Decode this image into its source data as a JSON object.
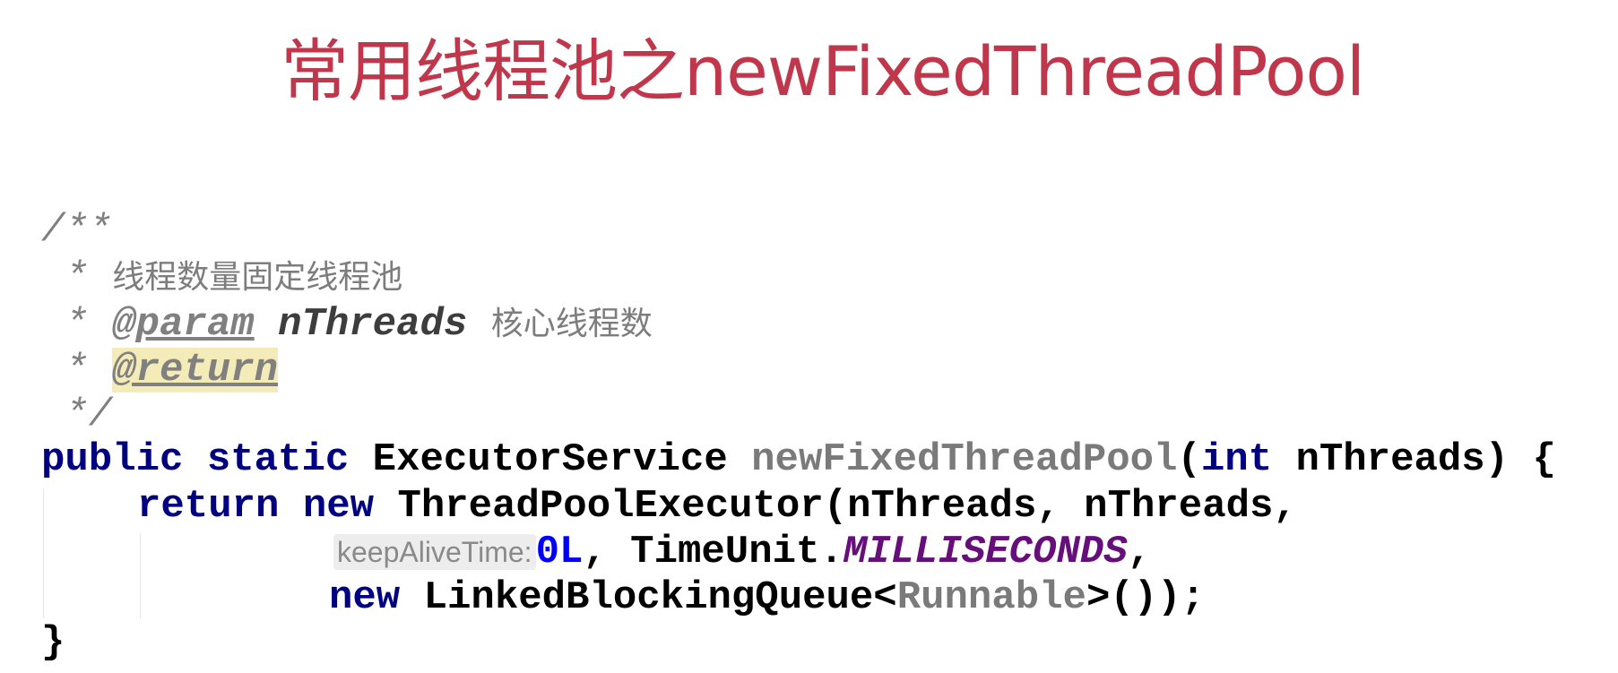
{
  "slide": {
    "title": "常用线程池之newFixedThreadPool",
    "colors": {
      "title": "#c0364a",
      "keyword": "#000080",
      "constant": "#660e7a",
      "number": "#0000ff",
      "comment": "#808080"
    }
  },
  "code": {
    "comment_open": "/**",
    "comment_star": " * ",
    "comment_desc": "线程数量固定线程池",
    "param_tag": "@param",
    "param_name": "nThreads",
    "param_desc": "核心线程数",
    "return_tag": "@return",
    "comment_close": " */",
    "l1_kw": "public static ",
    "l1_type": "ExecutorService ",
    "l1_method": "newFixedThreadPool",
    "l1_paren": "(",
    "l1_int": "int",
    "l1_rest": " nThreads) {",
    "l2_kw": "return new ",
    "l2_rest": "ThreadPoolExecutor(nThreads, nThreads,",
    "l3_hint": "keepAliveTime:",
    "l3_num": "0L",
    "l3_mid": ", TimeUnit.",
    "l3_const": "MILLISECONDS",
    "l3_end": ",",
    "l4_kw": "new ",
    "l4_type": "LinkedBlockingQueue<",
    "l4_gen": "Runnable",
    "l4_end": ">());",
    "close_brace": "}"
  }
}
